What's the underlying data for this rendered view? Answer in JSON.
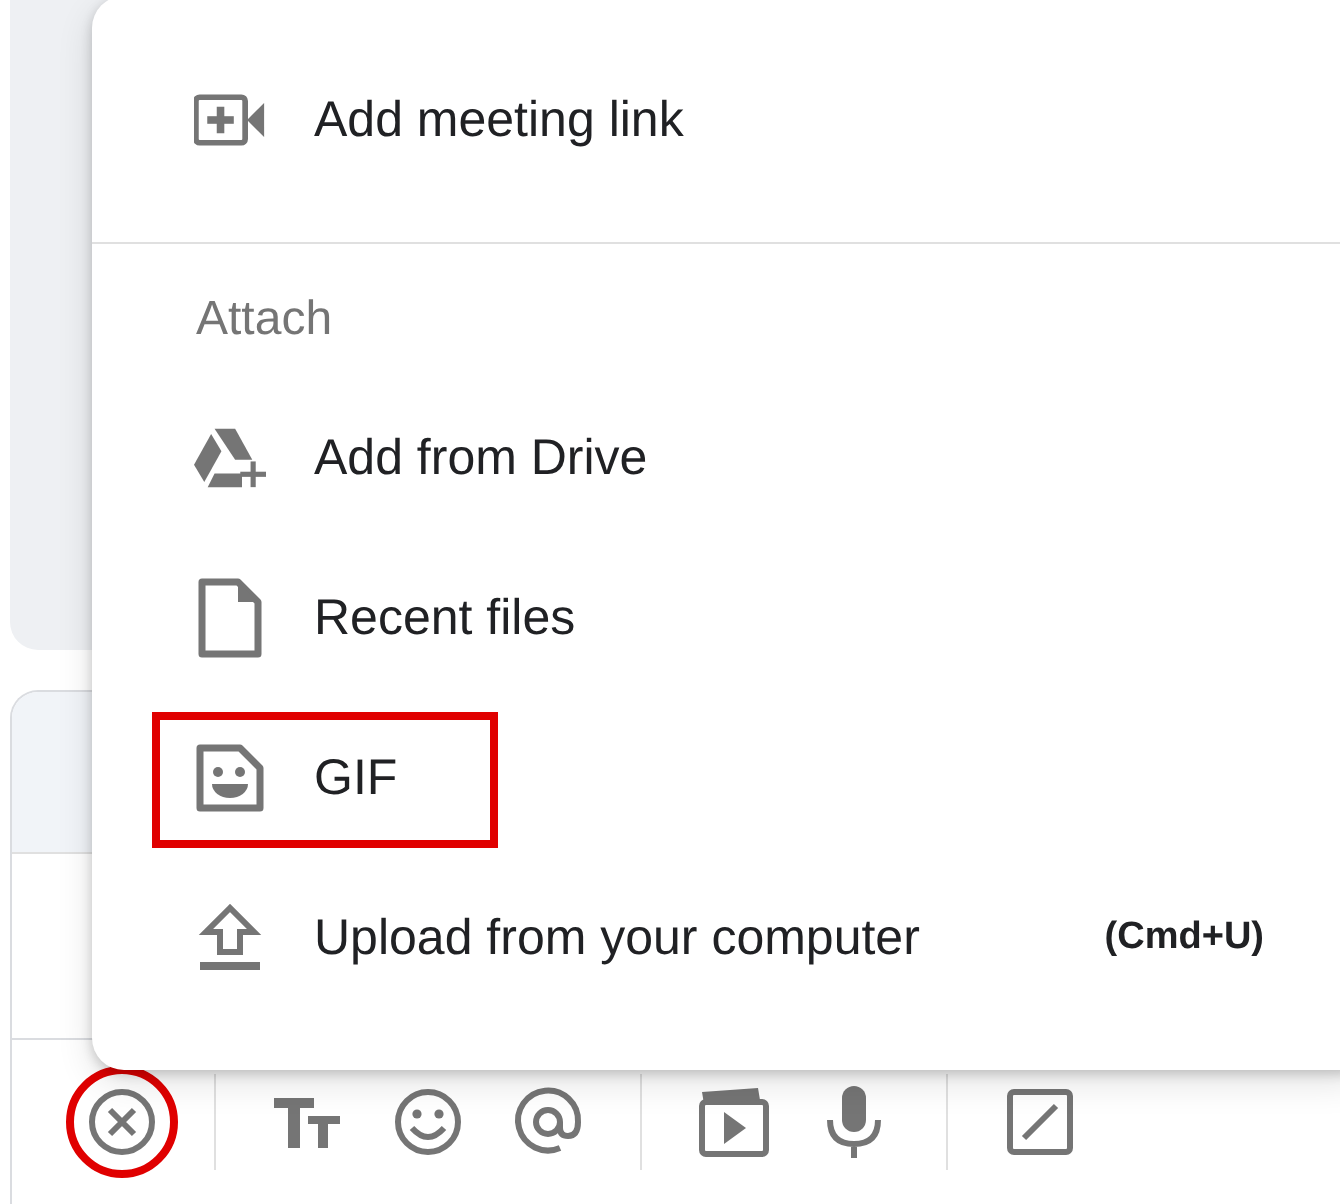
{
  "menu": {
    "sections": [
      {
        "items": [
          {
            "kind": "video",
            "label": "Add meeting link",
            "highlighted": false
          }
        ]
      },
      {
        "heading": "Attach",
        "items": [
          {
            "kind": "drive",
            "label": "Add from Drive",
            "highlighted": false
          },
          {
            "kind": "file",
            "label": "Recent files",
            "highlighted": false
          },
          {
            "kind": "gif",
            "label": "GIF",
            "highlighted": true
          },
          {
            "kind": "upload",
            "label": "Upload from your computer",
            "shortcut": "(Cmd+U)",
            "highlighted": false
          }
        ]
      }
    ]
  },
  "toolbar": [
    {
      "kind": "close",
      "highlighted": true
    },
    {
      "kind": "divider"
    },
    {
      "kind": "format"
    },
    {
      "kind": "emoji"
    },
    {
      "kind": "mention"
    },
    {
      "kind": "divider"
    },
    {
      "kind": "clip"
    },
    {
      "kind": "mic"
    },
    {
      "kind": "divider"
    },
    {
      "kind": "slash"
    }
  ]
}
